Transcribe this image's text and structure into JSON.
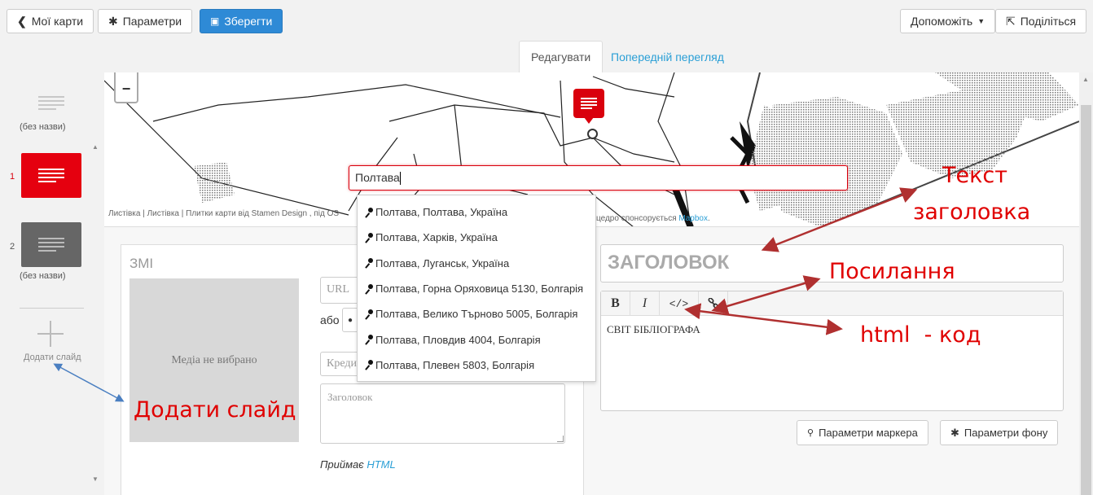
{
  "topbar": {
    "my_maps": "Мої карти",
    "settings": "Параметри",
    "save": "Зберегти",
    "help": "Допоможіть",
    "share": "Поділіться"
  },
  "tabs": {
    "edit": "Редагувати",
    "preview": "Попередній перегляд"
  },
  "sidebar": {
    "title_slide_label": "(без назви)",
    "slides": [
      {
        "number": "1",
        "label": ""
      },
      {
        "number": "2",
        "label": "(без назви)"
      }
    ],
    "add_slide": "Додати слайд"
  },
  "map": {
    "zoom_out": "−",
    "search_value": "Полтава",
    "attribution_left": "Листівка | Листівка | Плитки карти від Stamen Design , під OS",
    "attribution_right_a": "цедро спонсорується ",
    "attribution_right_link": "Mapbox",
    "attribution_right_b": "."
  },
  "suggestions": [
    "Полтава, Полтава, Україна",
    "Полтава, Харків, Україна",
    "Полтава, Луганськ, Україна",
    "Полтава, Горна Оряховица 5130, Болгарія",
    "Полтава, Велико Търново 5005, Болгарія",
    "Полтава, Пловдив 4004, Болгарія",
    "Полтава, Плевен 5803, Болгарія"
  ],
  "media": {
    "section_title": "ЗМІ",
    "no_media": "Медіа не вибрано",
    "url_placeholder": "URL",
    "or_label": "або",
    "credit_placeholder": "Креди",
    "caption_placeholder": "Заголовок",
    "accepts_prefix": "Приймає ",
    "accepts_link": "HTML"
  },
  "text": {
    "headline_placeholder": "ЗАГОЛОВОК",
    "bold": "B",
    "italic": "I",
    "code": "</>",
    "body_text": "СВІТ БІБЛІОГРАФА",
    "marker_settings": "Параметри маркера",
    "bg_settings": "Параметри фону"
  },
  "annotations": {
    "heading_text_1": "Текст",
    "heading_text_2": "заголовка",
    "link": "Посилання",
    "html": "html  - код",
    "add_slide": "Додати слайд"
  },
  "colors": {
    "accent": "#2e8ad6",
    "marker_red": "#d9000d",
    "annotation_red": "#e00000",
    "arrow_red": "#b03030",
    "arrow_blue": "#4a7fc1"
  }
}
